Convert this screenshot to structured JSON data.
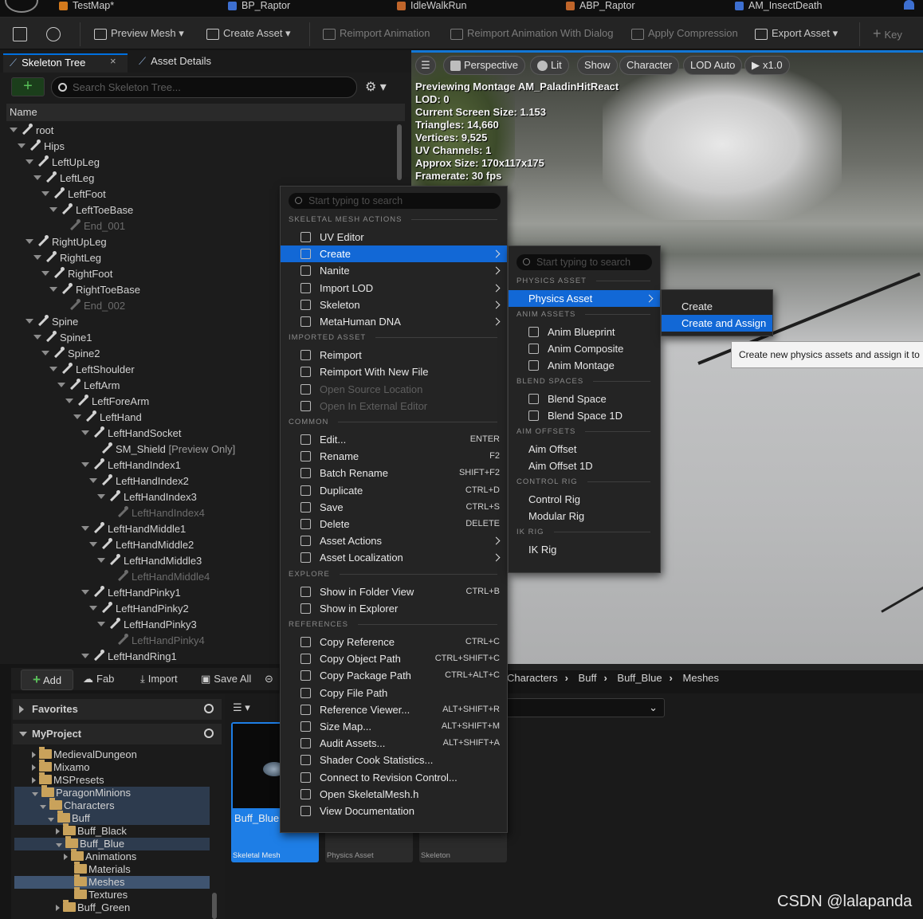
{
  "doc_tabs": [
    "TestMap*",
    "BP_Raptor",
    "IdleWalkRun",
    "ABP_Raptor",
    "AM_InsectDeath"
  ],
  "toolbar": {
    "preview_mesh": "Preview Mesh",
    "create_asset": "Create Asset",
    "reimport_animation": "Reimport Animation",
    "reimport_dialog": "Reimport Animation With Dialog",
    "apply_compression": "Apply Compression",
    "export_asset": "Export Asset",
    "key": "Key"
  },
  "left_panel": {
    "tab_skeleton": "Skeleton Tree",
    "tab_close": "×",
    "tab_details": "Asset Details",
    "add_symbol": "+",
    "search_placeholder": "Search Skeleton Tree...",
    "column_name": "Name"
  },
  "skeleton_tree": [
    {
      "label": "root",
      "depth": 0
    },
    {
      "label": "Hips",
      "depth": 1
    },
    {
      "label": "LeftUpLeg",
      "depth": 2
    },
    {
      "label": "LeftLeg",
      "depth": 3
    },
    {
      "label": "LeftFoot",
      "depth": 4
    },
    {
      "label": "LeftToeBase",
      "depth": 5
    },
    {
      "label": "End_001",
      "depth": 6,
      "dim": true
    },
    {
      "label": "RightUpLeg",
      "depth": 2
    },
    {
      "label": "RightLeg",
      "depth": 3
    },
    {
      "label": "RightFoot",
      "depth": 4
    },
    {
      "label": "RightToeBase",
      "depth": 5
    },
    {
      "label": "End_002",
      "depth": 6,
      "dim": true
    },
    {
      "label": "Spine",
      "depth": 2
    },
    {
      "label": "Spine1",
      "depth": 3
    },
    {
      "label": "Spine2",
      "depth": 4
    },
    {
      "label": "LeftShoulder",
      "depth": 5
    },
    {
      "label": "LeftArm",
      "depth": 6
    },
    {
      "label": "LeftForeArm",
      "depth": 7
    },
    {
      "label": "LeftHand",
      "depth": 8
    },
    {
      "label": "LeftHandSocket",
      "depth": 9
    },
    {
      "label": "SM_Shield",
      "depth": 10,
      "suffix": " [Preview Only]"
    },
    {
      "label": "LeftHandIndex1",
      "depth": 9
    },
    {
      "label": "LeftHandIndex2",
      "depth": 10
    },
    {
      "label": "LeftHandIndex3",
      "depth": 11
    },
    {
      "label": "LeftHandIndex4",
      "depth": 12,
      "dim": true
    },
    {
      "label": "LeftHandMiddle1",
      "depth": 9
    },
    {
      "label": "LeftHandMiddle2",
      "depth": 10
    },
    {
      "label": "LeftHandMiddle3",
      "depth": 11
    },
    {
      "label": "LeftHandMiddle4",
      "depth": 12,
      "dim": true
    },
    {
      "label": "LeftHandPinky1",
      "depth": 9
    },
    {
      "label": "LeftHandPinky2",
      "depth": 10
    },
    {
      "label": "LeftHandPinky3",
      "depth": 11
    },
    {
      "label": "LeftHandPinky4",
      "depth": 12,
      "dim": true
    },
    {
      "label": "LeftHandRing1",
      "depth": 9
    }
  ],
  "viewport": {
    "buttons": [
      "Perspective",
      "Lit",
      "Show",
      "Character",
      "LOD Auto",
      "x1.0"
    ],
    "info": [
      "Previewing Montage AM_PaladinHitReact",
      "LOD: 0",
      "Current Screen Size: 1.153",
      "Triangles: 14,660",
      "Vertices: 9,525",
      "UV Channels: 1",
      "Approx Size: 170x117x175",
      "Framerate: 30 fps"
    ]
  },
  "content_browser": {
    "add": "Add",
    "fab": "Fab",
    "import": "Import",
    "save_all": "Save All",
    "favorites": "Favorites",
    "project": "MyProject",
    "breadcrumb": [
      "Characters",
      "Buff",
      "Buff_Blue",
      "Meshes"
    ],
    "folders": [
      {
        "label": "MedievalDungeon",
        "depth": 1,
        "exp": "r"
      },
      {
        "label": "Mixamo",
        "depth": 1,
        "exp": "r"
      },
      {
        "label": "MSPresets",
        "depth": 1,
        "exp": "r"
      },
      {
        "label": "ParagonMinions",
        "depth": 1,
        "exp": "d",
        "open": true,
        "sel": true
      },
      {
        "label": "Characters",
        "depth": 2,
        "exp": "d",
        "open": true,
        "sel": true
      },
      {
        "label": "Buff",
        "depth": 3,
        "exp": "d",
        "open": true,
        "sel": true
      },
      {
        "label": "Buff_Black",
        "depth": 4,
        "exp": "r"
      },
      {
        "label": "Buff_Blue",
        "depth": 4,
        "exp": "d",
        "open": true,
        "sel": true
      },
      {
        "label": "Animations",
        "depth": 5,
        "exp": "r"
      },
      {
        "label": "Materials",
        "depth": 5
      },
      {
        "label": "Meshes",
        "depth": 5,
        "sel": "strong"
      },
      {
        "label": "Textures",
        "depth": 5
      },
      {
        "label": "Buff_Green",
        "depth": 4,
        "exp": "r"
      }
    ],
    "assets": [
      {
        "name": "Buff_Blue",
        "type": "Skeletal Mesh",
        "selected": true
      },
      {
        "name": "",
        "type": "Physics Asset"
      },
      {
        "name": "",
        "type": "Skeleton"
      }
    ]
  },
  "context_menu": {
    "search_placeholder": "Start typing to search",
    "sections": [
      {
        "header": "SKELETAL MESH ACTIONS",
        "items": [
          {
            "label": "UV Editor",
            "icon": "uv-editor-icon"
          },
          {
            "label": "Create",
            "icon": "create-icon",
            "sub": true,
            "hl": true
          },
          {
            "label": "Nanite",
            "icon": "nanite-icon",
            "sub": true
          },
          {
            "label": "Import LOD",
            "icon": "import-lod-icon",
            "sub": true
          },
          {
            "label": "Skeleton",
            "icon": "skeleton-icon",
            "sub": true
          },
          {
            "label": "MetaHuman DNA",
            "icon": "dna-icon",
            "sub": true
          }
        ]
      },
      {
        "header": "IMPORTED ASSET",
        "items": [
          {
            "label": "Reimport",
            "icon": "reimport-icon"
          },
          {
            "label": "Reimport With New File",
            "icon": "reimport-file-icon"
          },
          {
            "label": "Open Source Location",
            "icon": "folder-icon",
            "dis": true
          },
          {
            "label": "Open In External Editor",
            "icon": "external-icon",
            "dis": true
          }
        ]
      },
      {
        "header": "COMMON",
        "items": [
          {
            "label": "Edit...",
            "icon": "edit-icon",
            "sc": "ENTER"
          },
          {
            "label": "Rename",
            "icon": "rename-icon",
            "sc": "F2"
          },
          {
            "label": "Batch Rename",
            "icon": "batch-rename-icon",
            "sc": "SHIFT+F2"
          },
          {
            "label": "Duplicate",
            "icon": "duplicate-icon",
            "sc": "CTRL+D"
          },
          {
            "label": "Save",
            "icon": "save-icon",
            "sc": "CTRL+S"
          },
          {
            "label": "Delete",
            "icon": "delete-icon",
            "sc": "DELETE"
          },
          {
            "label": "Asset Actions",
            "icon": "wrench-icon",
            "sub": true
          },
          {
            "label": "Asset Localization",
            "icon": "flag-icon",
            "sub": true
          }
        ]
      },
      {
        "header": "EXPLORE",
        "items": [
          {
            "label": "Show in Folder View",
            "icon": "folder-view-icon",
            "sc": "CTRL+B"
          },
          {
            "label": "Show in Explorer",
            "icon": "explorer-icon"
          }
        ]
      },
      {
        "header": "REFERENCES",
        "items": [
          {
            "label": "Copy Reference",
            "icon": "copy-icon",
            "sc": "CTRL+C"
          },
          {
            "label": "Copy Object Path",
            "icon": "copy-icon",
            "sc": "CTRL+SHIFT+C"
          },
          {
            "label": "Copy Package Path",
            "icon": "copy-icon",
            "sc": "CTRL+ALT+C"
          },
          {
            "label": "Copy File Path",
            "icon": "copy-icon"
          },
          {
            "label": "Reference Viewer...",
            "icon": "reference-viewer-icon",
            "sc": "ALT+SHIFT+R"
          },
          {
            "label": "Size Map...",
            "icon": "size-map-icon",
            "sc": "ALT+SHIFT+M"
          },
          {
            "label": "Audit Assets...",
            "icon": "audit-icon",
            "sc": "ALT+SHIFT+A"
          },
          {
            "label": "Shader Cook Statistics...",
            "icon": "shader-icon"
          },
          {
            "label": "Connect to Revision Control...",
            "icon": "revision-icon"
          },
          {
            "label": "Open SkeletalMesh.h",
            "icon": "code-icon"
          },
          {
            "label": "View Documentation",
            "icon": "doc-icon"
          }
        ]
      }
    ]
  },
  "create_menu": {
    "search_placeholder": "Start typing to search",
    "sections": [
      {
        "header": "PHYSICS ASSET",
        "items": [
          {
            "label": "Physics Asset",
            "sub": true,
            "hl": true,
            "noicon": true
          }
        ]
      },
      {
        "header": "ANIM ASSETS",
        "items": [
          {
            "label": "Anim Blueprint",
            "icon": "anim-blueprint-icon"
          },
          {
            "label": "Anim Composite",
            "icon": "anim-composite-icon"
          },
          {
            "label": "Anim Montage",
            "icon": "anim-montage-icon"
          }
        ]
      },
      {
        "header": "BLEND SPACES",
        "items": [
          {
            "label": "Blend Space",
            "icon": "blend-space-icon"
          },
          {
            "label": "Blend Space 1D",
            "icon": "blend-space-1d-icon"
          }
        ]
      },
      {
        "header": "AIM OFFSETS",
        "items": [
          {
            "label": "Aim Offset",
            "noicon": true
          },
          {
            "label": "Aim Offset 1D",
            "noicon": true
          }
        ]
      },
      {
        "header": "CONTROL RIG",
        "items": [
          {
            "label": "Control Rig",
            "noicon": true
          },
          {
            "label": "Modular Rig",
            "noicon": true
          }
        ]
      },
      {
        "header": "IK RIG",
        "items": [
          {
            "label": "IK Rig",
            "noicon": true
          }
        ]
      }
    ]
  },
  "physics_menu": {
    "items": [
      {
        "label": "Create"
      },
      {
        "label": "Create and Assign",
        "hl": true
      }
    ]
  },
  "tooltip": "Create new physics assets and assign it to",
  "watermark": "CSDN @lalapanda"
}
